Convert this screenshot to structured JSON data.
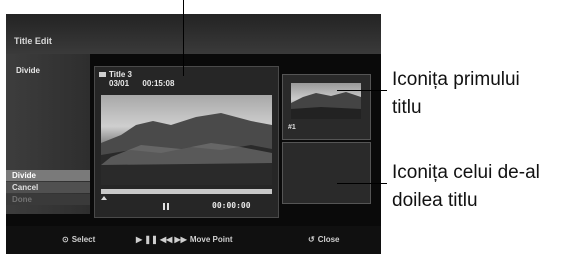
{
  "screen": {
    "title": "Title Edit",
    "mode_label": "Divide",
    "menu": [
      {
        "label": "Divide",
        "state": "selected"
      },
      {
        "label": "Cancel",
        "state": "normal"
      },
      {
        "label": "Done",
        "state": "disabled"
      }
    ],
    "preview": {
      "title": "Title 3",
      "date": "03/01",
      "time": "00:15:08",
      "timecode": "00:00:00"
    },
    "thumb1_label": "#1",
    "hints": {
      "select": "Select",
      "move_point": "Move Point",
      "close": "Close"
    }
  },
  "callouts": {
    "first_line1": "Iconița primului",
    "first_line2": "titlu",
    "second_line1": "Iconița celui de-al",
    "second_line2": "doilea titlu"
  }
}
